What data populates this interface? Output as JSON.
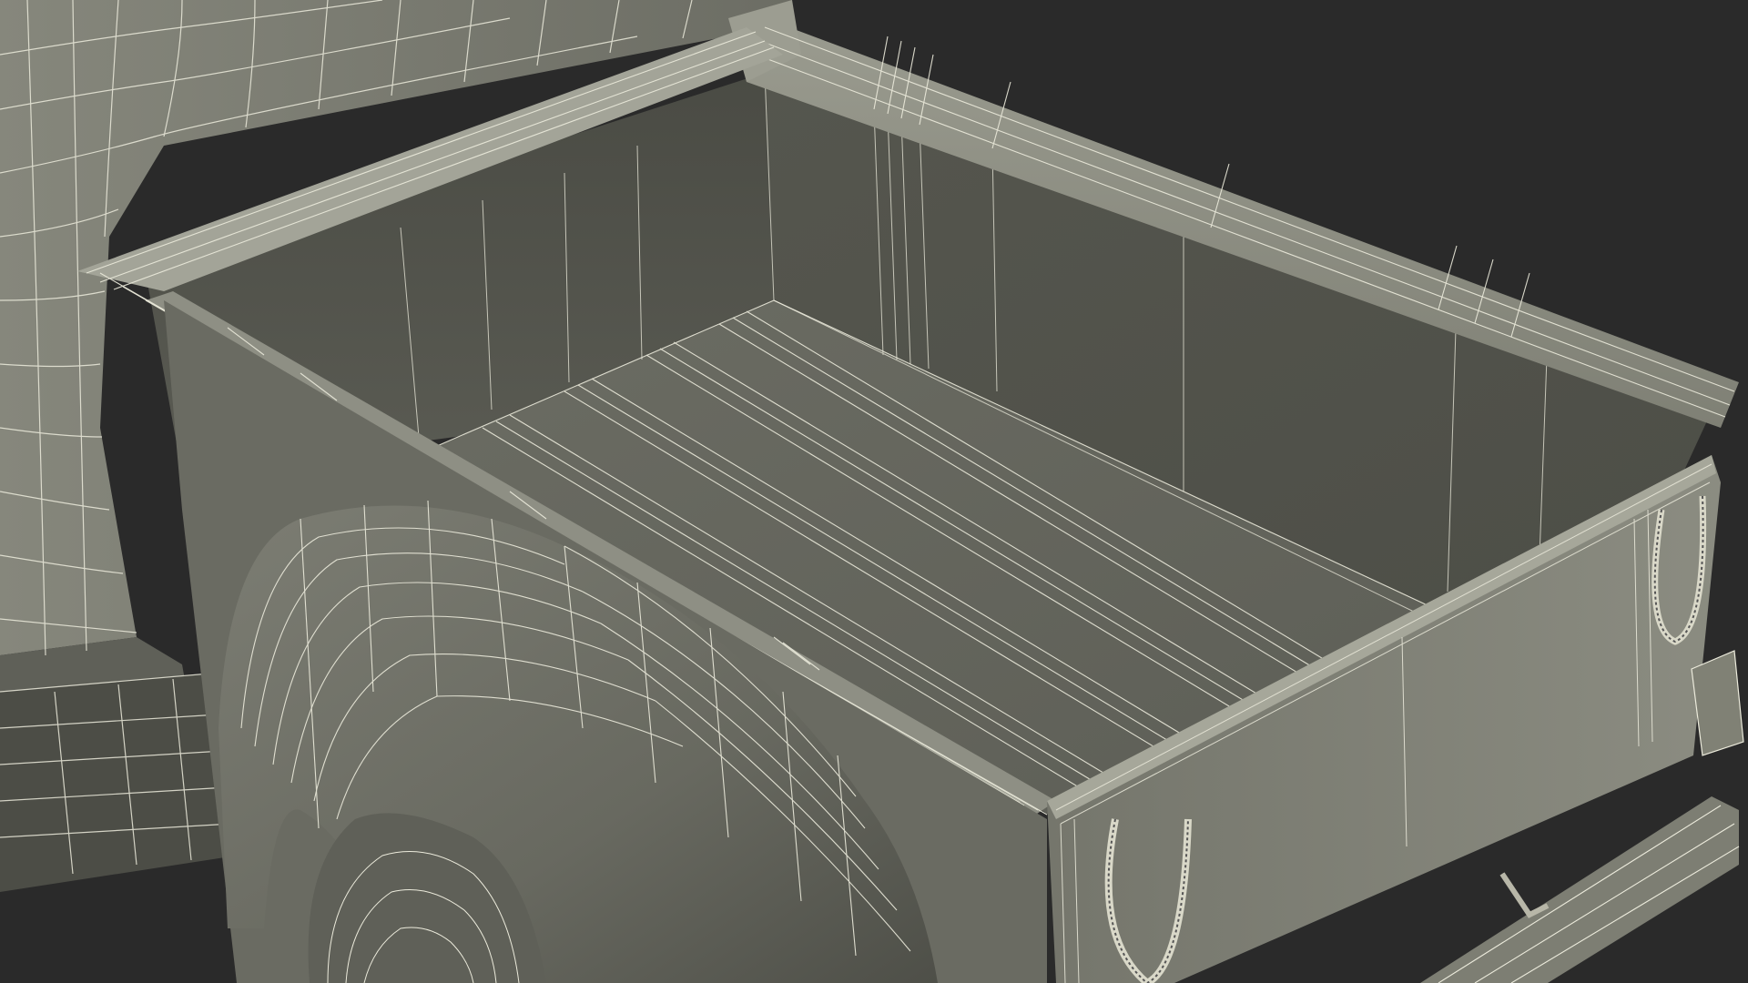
{
  "scene": {
    "subject": "pickup-truck-bed-wireframe-render",
    "colors": {
      "background": "#2a2a2a",
      "surface_light": "#8a8b80",
      "surface_mid": "#6f7067",
      "surface_dark": "#55564e",
      "surface_shadow": "#404139",
      "wire": "#ecebdc",
      "edge_dark": "#2e2f2a"
    }
  }
}
